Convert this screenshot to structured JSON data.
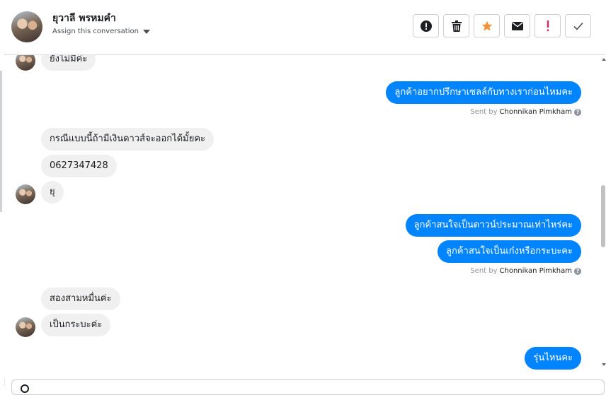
{
  "header": {
    "contact_name": "ยุวาลี พรหมคำ",
    "assign_label": "Assign this conversation",
    "actions": [
      {
        "name": "spam",
        "icon": "exclamation-circle-icon"
      },
      {
        "name": "delete",
        "icon": "trash-icon"
      },
      {
        "name": "star",
        "icon": "star-icon",
        "color": "#f7923a"
      },
      {
        "name": "mark-unread",
        "icon": "envelope-icon"
      },
      {
        "name": "follow-up",
        "icon": "exclamation-icon",
        "color": "#e0245e"
      },
      {
        "name": "done",
        "icon": "checkmark-icon"
      }
    ]
  },
  "messages": {
    "m1": "ยังไม่มีค่ะ",
    "m2": "ลูกค้าอยากปรึกษาเซลล์กับทางเราก่อนไหมคะ",
    "m3": "กรณีแบบนี้ถ้ามีเงินดาวส์จะออกได้มั้ยคะ",
    "m4": "0627347428",
    "m5": "ยุ",
    "m6": "ลูกค้าสนใจเป็นดาวน์ประมาณเท่าไหร่คะ",
    "m7": "ลูกค้าสนใจเป็นเก๋งหรือกระบะคะ",
    "m8": "สองสามหมื่นค่ะ",
    "m9": "เป็นกระบะค่ะ",
    "m10": "รุ่นไหนคะ"
  },
  "sent_by": {
    "prefix": "Sent by",
    "agent": "Chonnikan Pimkham",
    "help": "?"
  },
  "colors": {
    "outgoing_bubble": "#0084ff",
    "incoming_bubble": "#f0f0f0"
  }
}
